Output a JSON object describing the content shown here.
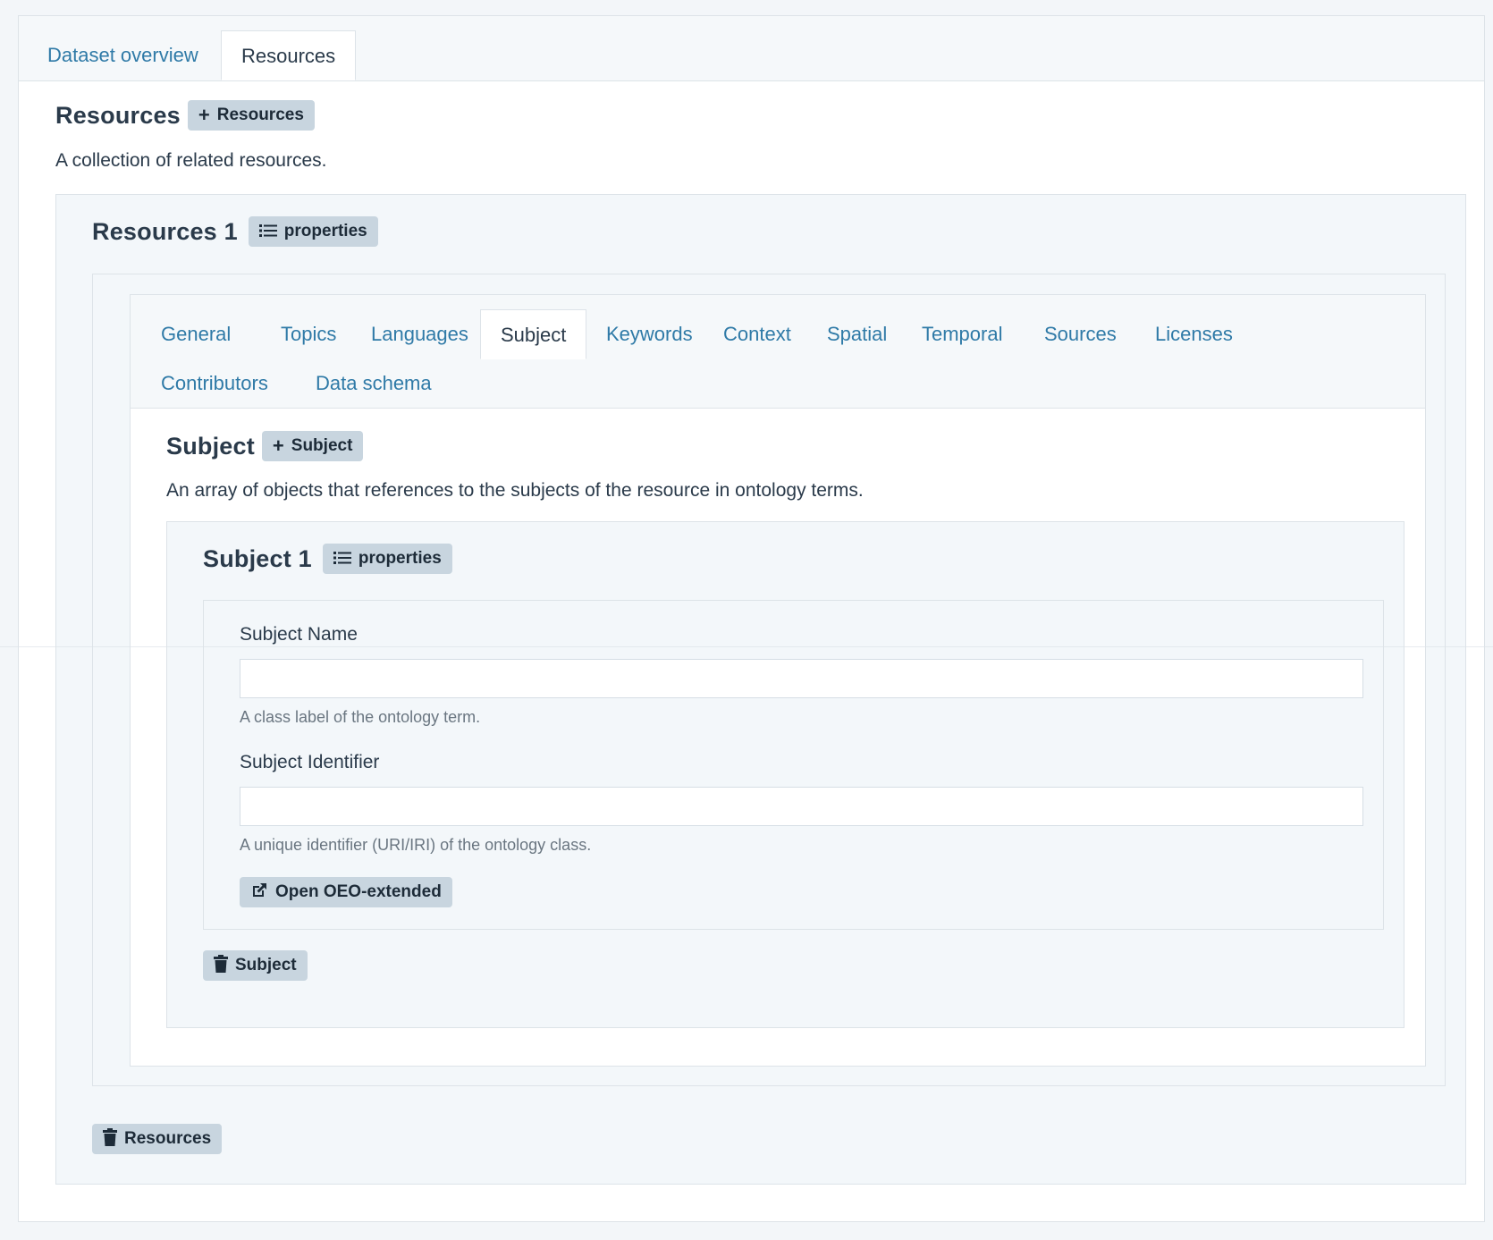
{
  "top_tabs": [
    {
      "label": "Dataset overview",
      "active": false
    },
    {
      "label": "Resources",
      "active": true
    }
  ],
  "resources": {
    "title": "Resources",
    "add_label": "Resources",
    "description": "A collection of related resources.",
    "item_title": "Resources 1",
    "properties_label": "properties",
    "delete_label": "Resources"
  },
  "inner_tabs": [
    {
      "label": "General",
      "active": false
    },
    {
      "label": "Topics",
      "active": false
    },
    {
      "label": "Languages",
      "active": false
    },
    {
      "label": "Subject",
      "active": true
    },
    {
      "label": "Keywords",
      "active": false
    },
    {
      "label": "Context",
      "active": false
    },
    {
      "label": "Spatial",
      "active": false
    },
    {
      "label": "Temporal",
      "active": false
    },
    {
      "label": "Sources",
      "active": false
    },
    {
      "label": "Licenses",
      "active": false
    },
    {
      "label": "Contributors",
      "active": false
    },
    {
      "label": "Data schema",
      "active": false
    }
  ],
  "subject": {
    "title": "Subject",
    "add_label": "Subject",
    "description": "An array of objects that references to the subjects of the resource in ontology terms.",
    "item_title": "Subject 1",
    "properties_label": "properties",
    "name_label": "Subject Name",
    "name_value": "",
    "name_help": "A class label of the ontology term.",
    "identifier_label": "Subject Identifier",
    "identifier_value": "",
    "identifier_help": "A unique identifier (URI/IRI) of the ontology class.",
    "open_button_label": "Open OEO-extended",
    "delete_label": "Subject"
  },
  "icons": {
    "plus": "plus-icon",
    "list": "list-icon",
    "trash": "trash-icon",
    "external": "external-link-icon"
  },
  "colors": {
    "link": "#2f7aa7",
    "button_bg": "#c8d5df",
    "panel_bg": "#f3f7fa",
    "border": "#dde3e8"
  }
}
